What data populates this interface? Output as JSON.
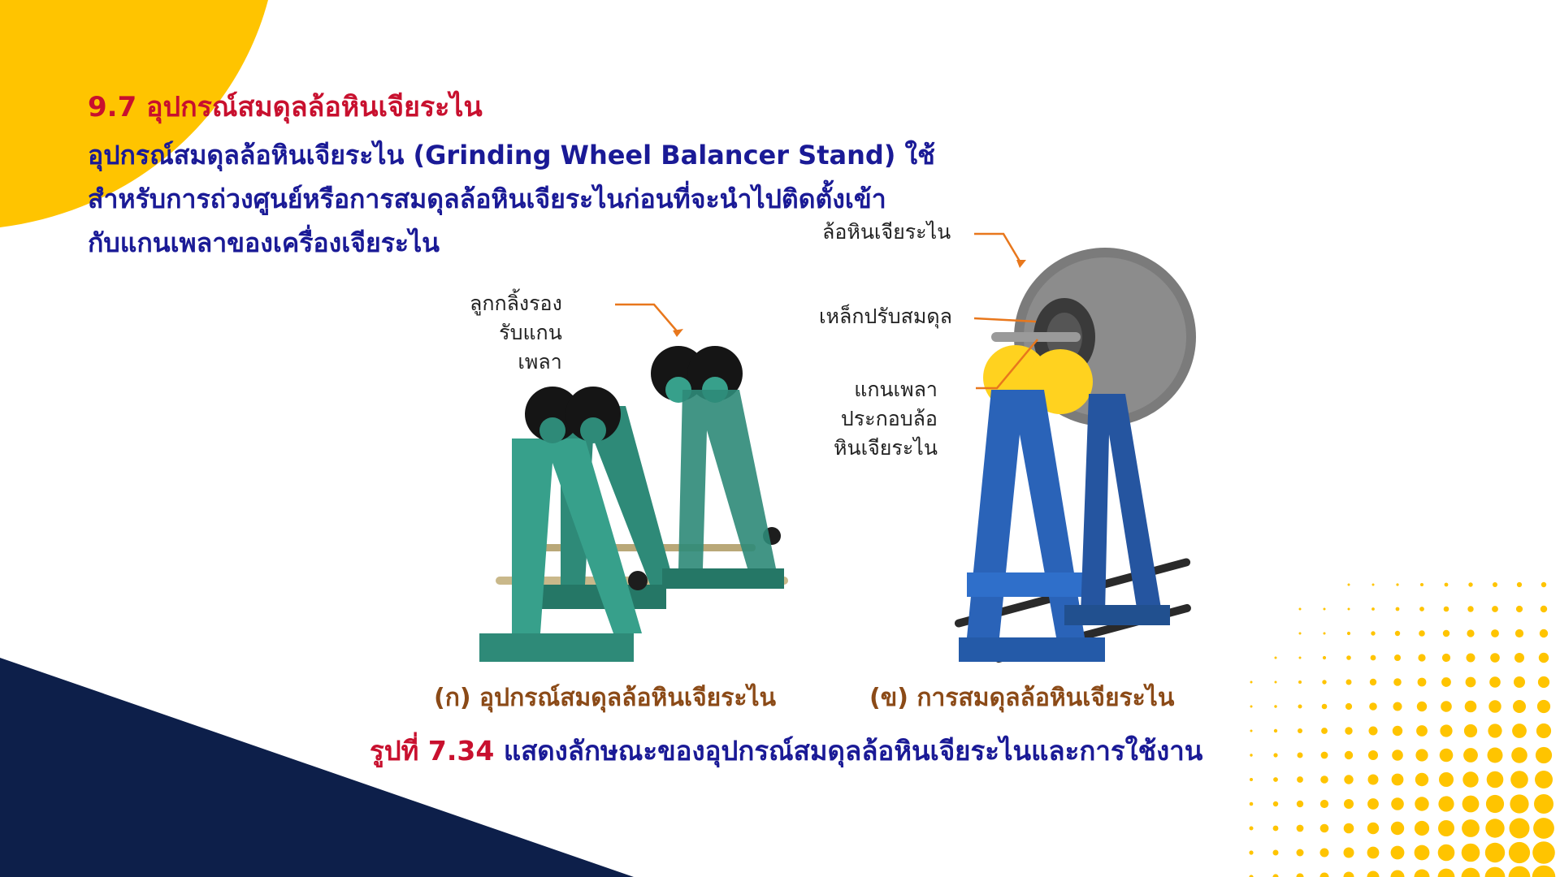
{
  "slide": {
    "heading": "9.7 อุปกรณ์สมดุลล้อหินเจียระไน",
    "intro_lines": [
      "อุปกรณ์สมดุลล้อหินเจียระไน (Grinding Wheel Balancer Stand) ใช้",
      "สำหรับการถ่วงศูนย์หรือการสมดุลล้อหินเจียระไนก่อนที่จะนำไปติดตั้งเข้า",
      "กับแกนเพลาของเครื่องเจียระไน"
    ]
  },
  "figure_a": {
    "label_lines": [
      "ลูกกลิ้งรอง",
      "รับแกน",
      "เพลา"
    ],
    "subcaption": "(ก) อุปกรณ์สมดุลล้อหินเจียระไน"
  },
  "figure_b": {
    "label_wheel": "ล้อหินเจียระไน",
    "label_weight": "เหล็กปรับสมดุล",
    "label_shaft_lines": [
      "แกนเพลา",
      "ประกอบล้อ",
      "หินเจียระไน"
    ],
    "subcaption": "(ข) การสมดุลล้อหินเจียระไน"
  },
  "caption": {
    "number": "รูปที่ 7.34",
    "text": " แสดงลักษณะของอุปกรณ์สมดุลล้อหินเจียระไนและการใช้งาน"
  },
  "colors": {
    "heading": "#c8102e",
    "body_text": "#1a1a96",
    "subcaption": "#8b4a17",
    "accent_yellow": "#ffc400",
    "navy": "#0d1f4a",
    "stand_green": "#2e8a78",
    "stand_blue": "#2a63b8",
    "leader_orange": "#e8771c"
  }
}
